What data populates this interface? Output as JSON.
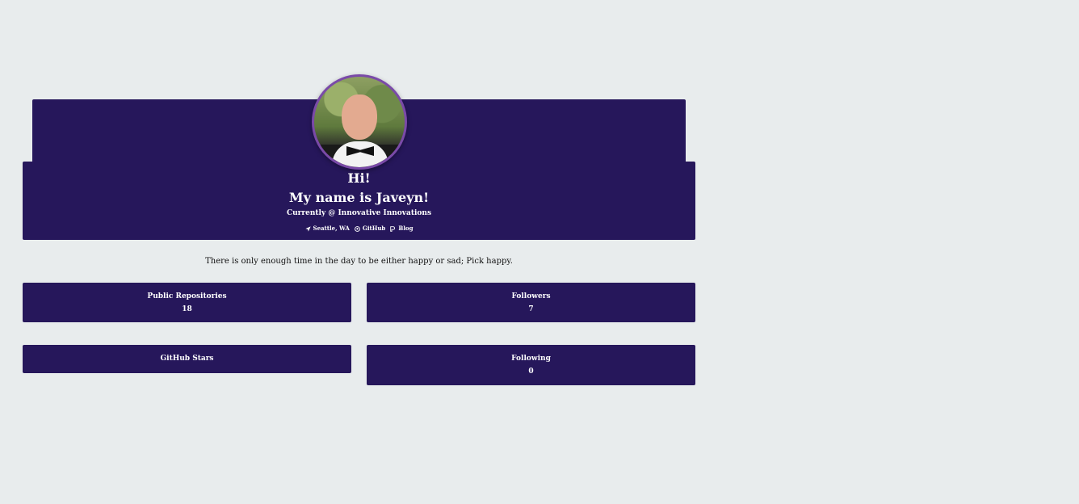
{
  "header": {
    "greeting": "Hi!",
    "name": "My name is Javeyn!",
    "currently": "Currently @ Innovative Innovations",
    "links": {
      "location": "Seattle, WA",
      "github": "GitHub",
      "blog": "Blog"
    }
  },
  "tagline": "There is only enough time in the day to be either happy or sad; Pick happy.",
  "stats": {
    "repos": {
      "label": "Public Repositories",
      "value": "18"
    },
    "followers": {
      "label": "Followers",
      "value": "7"
    },
    "stars": {
      "label": "GitHub Stars",
      "value": ""
    },
    "following": {
      "label": "Following",
      "value": "0"
    }
  },
  "colors": {
    "background": "#e8eced",
    "card": "#26175b",
    "avatar_border": "#7a4aa8",
    "text_light": "#ffffff"
  },
  "icons": {
    "location": "location-arrow-icon",
    "github": "github-icon",
    "blog": "blog-icon"
  }
}
